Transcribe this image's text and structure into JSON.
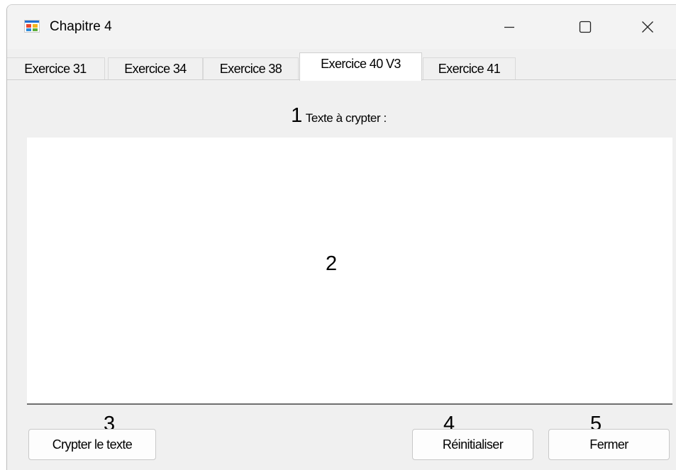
{
  "window": {
    "title": "Chapitre 4"
  },
  "tabs": [
    {
      "label": "Exercice 31"
    },
    {
      "label": "Exercice 34"
    },
    {
      "label": "Exercice 38"
    },
    {
      "label": "Exercice 40 V3",
      "selected": true
    },
    {
      "label": "Exercice 41"
    }
  ],
  "page": {
    "input_marker": "1",
    "input_label": "Texte à crypter :",
    "textarea_marker": "2",
    "textarea_value": "",
    "encrypt_marker": "3",
    "reset_marker": "4",
    "close_marker": "5"
  },
  "buttons": {
    "encrypt": "Crypter le texte",
    "reset": "Réinitialiser",
    "close": "Fermer"
  },
  "icons": {
    "app": "windows-forms-app-icon",
    "minimize": "minimize-icon",
    "maximize": "maximize-icon",
    "close": "close-icon"
  }
}
